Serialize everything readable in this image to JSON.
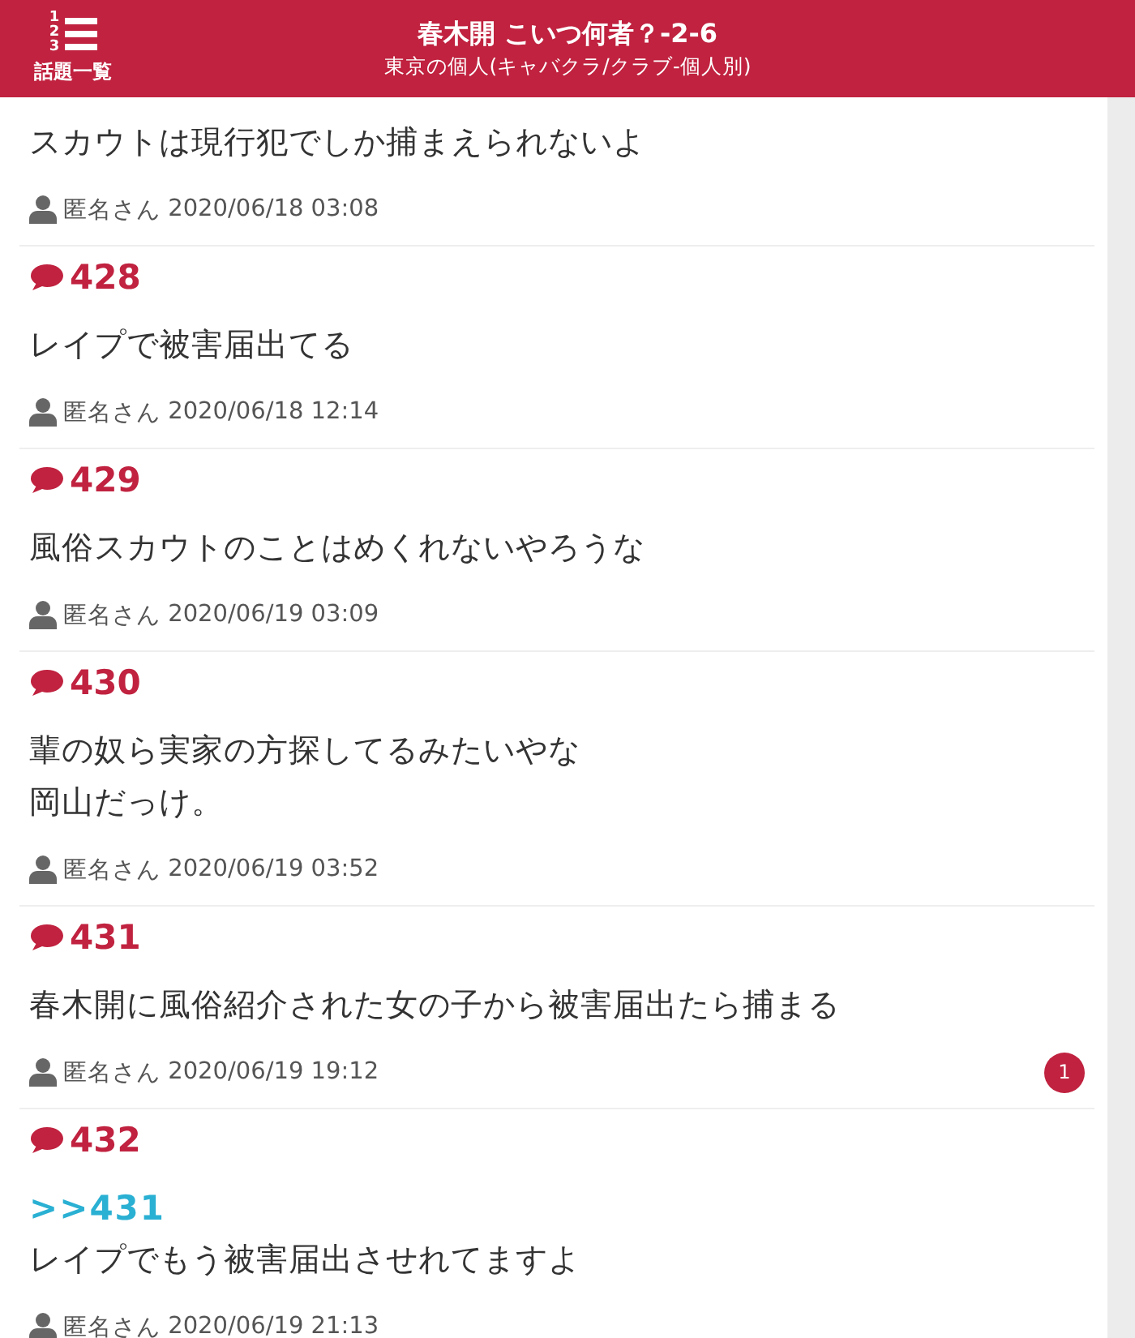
{
  "header": {
    "menu": {
      "digits": [
        "1",
        "2",
        "3"
      ],
      "label": "話題一覧"
    },
    "title": "春木開 こいつ何者？-2-6",
    "subtitle": "東京の個人(キャバクラ/クラブ-個人別)"
  },
  "posts": [
    {
      "lines": [
        "スカウトは現行犯でしか捕まえられないよ"
      ],
      "author": "匿名さん",
      "date": "2020/06/18 03:08"
    },
    {
      "number": "428",
      "lines": [
        "レイプで被害届出てる"
      ],
      "author": "匿名さん",
      "date": "2020/06/18 12:14"
    },
    {
      "number": "429",
      "lines": [
        "風俗スカウトのことはめくれないやろうな"
      ],
      "author": "匿名さん",
      "date": "2020/06/19 03:09"
    },
    {
      "number": "430",
      "lines": [
        "輩の奴ら実家の方探してるみたいやな",
        "岡山だっけ。"
      ],
      "author": "匿名さん",
      "date": "2020/06/19 03:52"
    },
    {
      "number": "431",
      "lines": [
        "春木開に風俗紹介された女の子から被害届出たら捕まる"
      ],
      "author": "匿名さん",
      "date": "2020/06/19 19:12",
      "reply_count": "1"
    },
    {
      "number": "432",
      "reply_to": ">>431",
      "lines": [
        "レイプでもう被害届出させれてますよ"
      ],
      "author": "匿名さん",
      "date": "2020/06/19 21:13"
    }
  ]
}
